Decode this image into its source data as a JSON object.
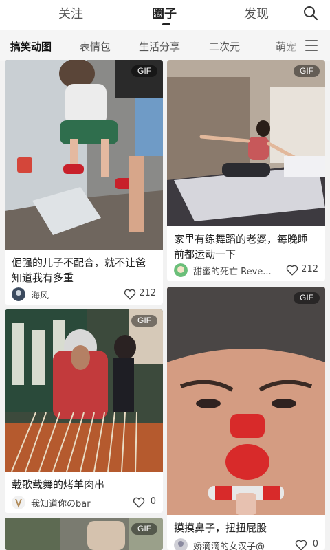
{
  "top_tabs": {
    "follow": "关注",
    "circle": "圈子",
    "discover": "发现"
  },
  "categories": [
    "搞笑动图",
    "表情包",
    "生活分享",
    "二次元",
    "萌宠"
  ],
  "gif_label": "GIF",
  "posts": [
    {
      "title_lines": [
        "倔强的儿子不配合，就不让爸",
        "知道我有多重"
      ],
      "author": "海风",
      "likes": "212"
    },
    {
      "title_lines": [
        "家里有练舞蹈的老婆，每晚睡",
        "前都运动一下"
      ],
      "author": "甜蜜的死亡 Reve...",
      "likes": "212"
    },
    {
      "title_lines": [
        "载歌载舞的烤羊肉串"
      ],
      "author": "我知道你のbar",
      "likes": "0"
    },
    {
      "title_lines": [
        "摸摸鼻子，扭扭屁股"
      ],
      "author": "娇滴滴的女汉子@",
      "likes": "0"
    }
  ],
  "colors": {
    "accent": "#222222",
    "background": "#f2f2f2",
    "gif_badge": "rgba(0,0,0,0.45)"
  },
  "icons": [
    "search-icon",
    "menu-icon",
    "heart-icon",
    "avatar"
  ]
}
